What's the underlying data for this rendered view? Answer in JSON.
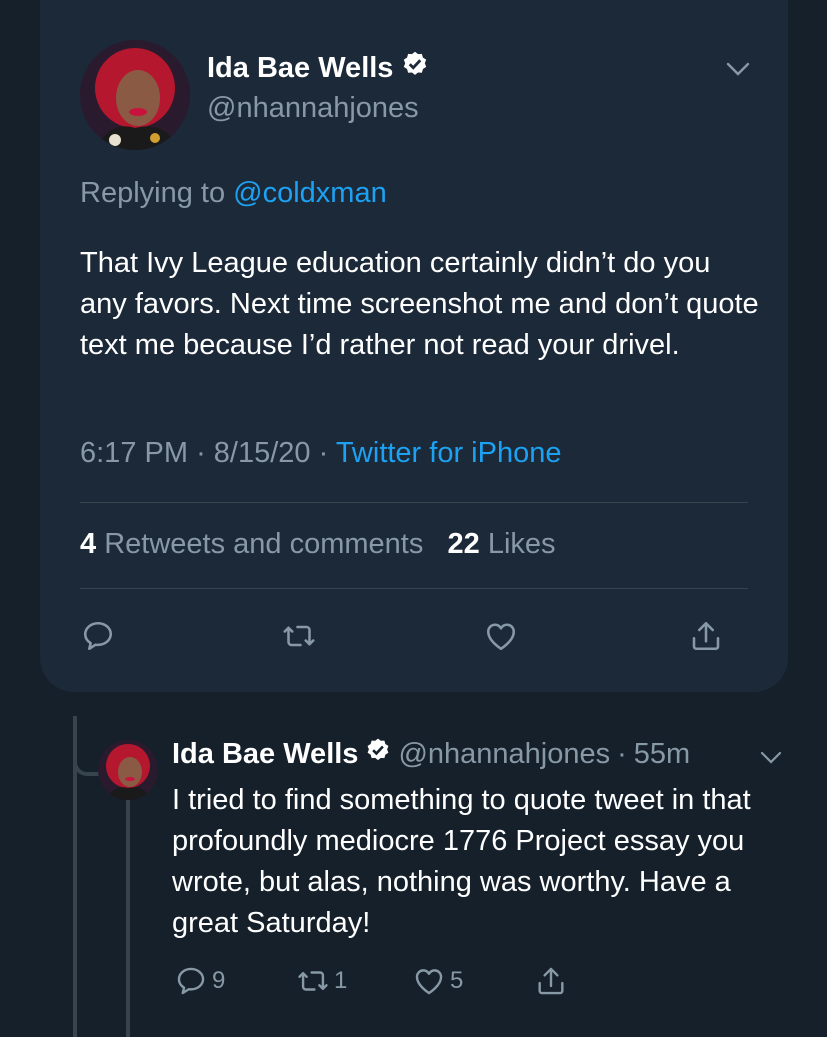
{
  "tweet": {
    "name": "Ida Bae Wells",
    "handle": "@nhannahjones",
    "replying_prefix": "Replying to ",
    "replying_to": "@coldxman",
    "text": "That Ivy League education certainly didn’t do you any favors. Next time screenshot me and don’t quote text me because I’d rather not read your drivel.",
    "time": "6:17 PM",
    "date": "8/15/20",
    "source": "Twitter for iPhone",
    "retweets_count": "4",
    "retweets_label": "Retweets and comments",
    "likes_count": "22",
    "likes_label": "Likes"
  },
  "reply": {
    "name": "Ida Bae Wells",
    "handle": "@nhannahjones",
    "age": "55m",
    "text": "I tried to find something to quote tweet in that profoundly mediocre 1776 Project essay you wrote, but alas, nothing was worthy. Have a great Saturday!",
    "reply_count": "9",
    "retweet_count": "1",
    "like_count": "5"
  },
  "colors": {
    "background": "#15202b",
    "card": "#1c2938",
    "accent": "#1da1f2",
    "muted": "#8899a6"
  }
}
